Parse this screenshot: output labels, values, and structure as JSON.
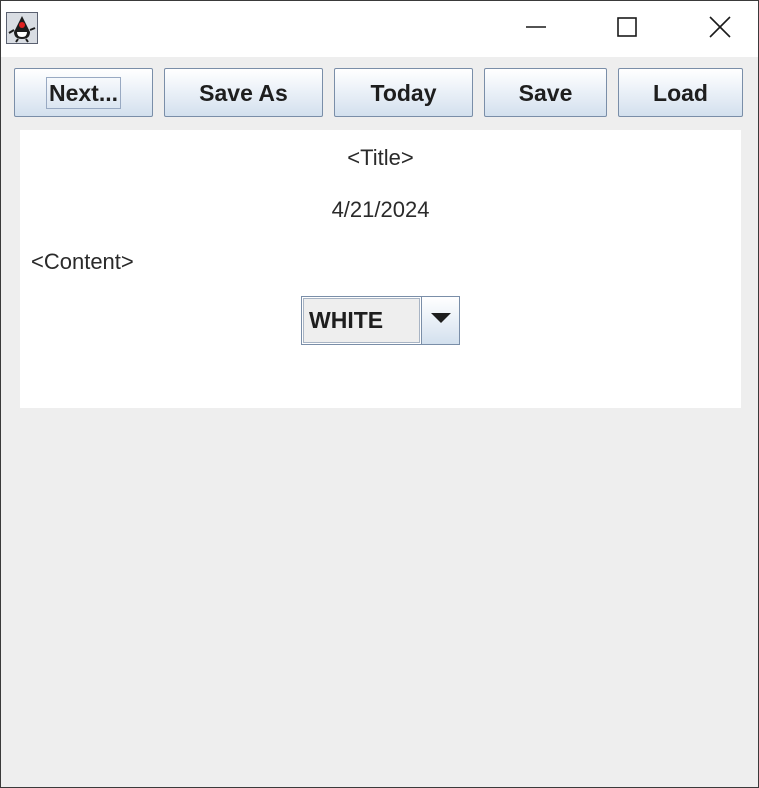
{
  "window": {
    "icon": "java-duke-icon"
  },
  "toolbar": {
    "next_label": "Next...",
    "save_as_label": "Save As",
    "today_label": "Today",
    "save_label": "Save",
    "load_label": "Load"
  },
  "main": {
    "title": "<Title>",
    "date": "4/21/2024",
    "content": "<Content>",
    "color_select": {
      "value": "WHITE"
    }
  },
  "colors": {
    "button_border": "#7a8ea8",
    "button_gradient_bottom": "#d3e0ee",
    "window_background": "#eeeeee",
    "panel_background": "#ffffff"
  }
}
